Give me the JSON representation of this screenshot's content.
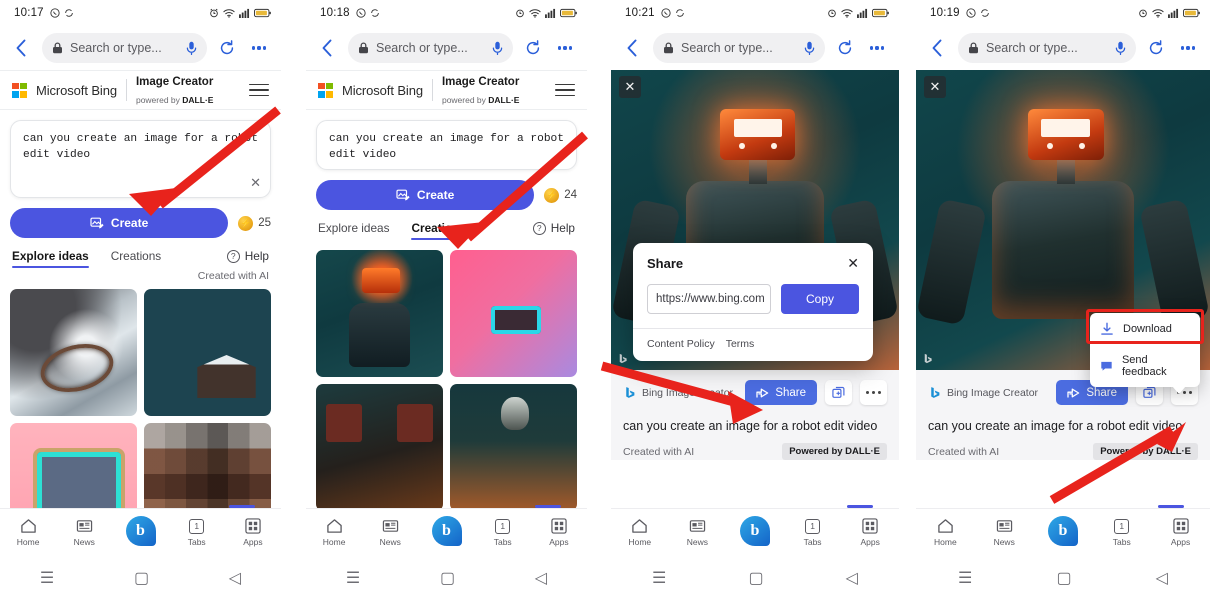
{
  "screens": [
    {
      "id": "screen-1",
      "status": {
        "time": "10:17",
        "icons": [
          "whatsapp-icon",
          "sync-icon",
          "alarm-icon",
          "wifi-icon",
          "signal-icon",
          "battery-icon"
        ]
      },
      "chrome": {
        "back": "‹",
        "lock_icon": "lock-icon",
        "omnibox_placeholder": "Search or type...",
        "mic_icon": "microphone-icon",
        "reload_icon": "reload-icon",
        "more_icon": "more-icon"
      },
      "header": {
        "brand": "Microsoft Bing",
        "product": "Image Creator",
        "tagline_prefix": "powered by ",
        "tagline_brand": "DALL·E",
        "menu_icon": "hamburger-menu-icon"
      },
      "composer": {
        "value": "can you create an image for a robot edit video",
        "clear_icon": "clear-icon"
      },
      "create": {
        "label": "Create",
        "icon": "create-image-icon"
      },
      "credits": {
        "value": "25",
        "coin_icon": "coin-icon"
      },
      "tabs": [
        {
          "label": "Explore ideas",
          "active": true
        },
        {
          "label": "Creations",
          "active": false
        }
      ],
      "help": {
        "label": "Help",
        "icon": "question-circle-icon"
      },
      "created_with_ai": "Created with AI",
      "gallery_kind": "explore",
      "gallery": [
        {
          "name": "pearl-ring-thumbnail",
          "art": "art-ring"
        },
        {
          "name": "snow-cabin-thumbnail",
          "art": "art-cabin"
        },
        {
          "name": "retro-tv-thumbnail",
          "art": "art-tv"
        },
        {
          "name": "pixel-mosaic-thumbnail",
          "art": "art-mosaic"
        }
      ]
    },
    {
      "id": "screen-2",
      "status": {
        "time": "10:18"
      },
      "chrome": {
        "omnibox_placeholder": "Search or type..."
      },
      "header": {
        "brand": "Microsoft Bing",
        "product": "Image Creator",
        "tagline_prefix": "powered by ",
        "tagline_brand": "DALL·E"
      },
      "composer": {
        "value": "can you create an image for a robot edit video"
      },
      "create": {
        "label": "Create"
      },
      "credits": {
        "value": "24"
      },
      "tabs": [
        {
          "label": "Explore ideas",
          "active": false
        },
        {
          "label": "Creations",
          "active": true
        }
      ],
      "help": {
        "label": "Help"
      },
      "gallery_kind": "creations",
      "gallery": [
        {
          "name": "robot-result-1-thumbnail",
          "art": "art-robot1"
        },
        {
          "name": "robot-result-2-thumbnail",
          "art": "art-robot2"
        },
        {
          "name": "robot-result-3-thumbnail",
          "art": "art-robot3"
        },
        {
          "name": "robot-result-4-thumbnail",
          "art": "art-robot4"
        }
      ]
    },
    {
      "id": "screen-3",
      "status": {
        "time": "10:21"
      },
      "chrome": {
        "omnibox_placeholder": "Search or type..."
      },
      "hero": {
        "close_label": "✕"
      },
      "detail": {
        "brand": "Bing Image Creator",
        "share_label": "Share",
        "share_icon": "share-icon",
        "collections_icon": "add-to-collections-icon",
        "more_icon": "more-options-icon",
        "prompt": "can you create an image for a robot edit video",
        "created_with_ai": "Created with AI",
        "dalle_badge": "Powered by DALL·E"
      },
      "share_dialog": {
        "title": "Share",
        "close_label": "✕",
        "url": "https://www.bing.com",
        "copy_label": "Copy",
        "links": [
          "Content Policy",
          "Terms"
        ]
      }
    },
    {
      "id": "screen-4",
      "status": {
        "time": "10:19"
      },
      "chrome": {
        "omnibox_placeholder": "Search or type..."
      },
      "hero": {
        "close_label": "✕"
      },
      "detail": {
        "brand": "Bing Image Creator",
        "share_label": "Share",
        "prompt": "can you create an image for a robot edit video",
        "created_with_ai": "Created with AI",
        "dalle_badge": "Powered by DALL·E"
      },
      "dropdown": {
        "items": [
          {
            "label": "Download",
            "icon": "download-icon",
            "highlighted": true
          },
          {
            "label": "Send feedback",
            "icon": "feedback-icon",
            "highlighted": false
          }
        ]
      }
    }
  ],
  "bottom_nav": [
    {
      "label": "Home",
      "icon": "home-icon"
    },
    {
      "label": "News",
      "icon": "news-icon"
    },
    {
      "label": "",
      "icon": "bing-logo-icon"
    },
    {
      "label": "Tabs",
      "icon": "tabs-icon",
      "count": "1"
    },
    {
      "label": "Apps",
      "icon": "apps-icon"
    }
  ],
  "system_nav": [
    {
      "name": "recents-button",
      "glyph": "☰"
    },
    {
      "name": "home-button",
      "glyph": "▢"
    },
    {
      "name": "back-button",
      "glyph": "◁"
    }
  ],
  "annotations": {
    "arrow_color": "#e8231c",
    "highlight_color": "#e8231c",
    "arrows": [
      {
        "name": "arrow-to-create-button",
        "target": "create-button"
      },
      {
        "name": "arrow-to-creations-gallery",
        "target": "creations-gallery"
      },
      {
        "name": "arrow-to-share-button",
        "target": "share-button"
      },
      {
        "name": "arrow-to-more-options-button",
        "target": "more-options-button"
      }
    ]
  }
}
